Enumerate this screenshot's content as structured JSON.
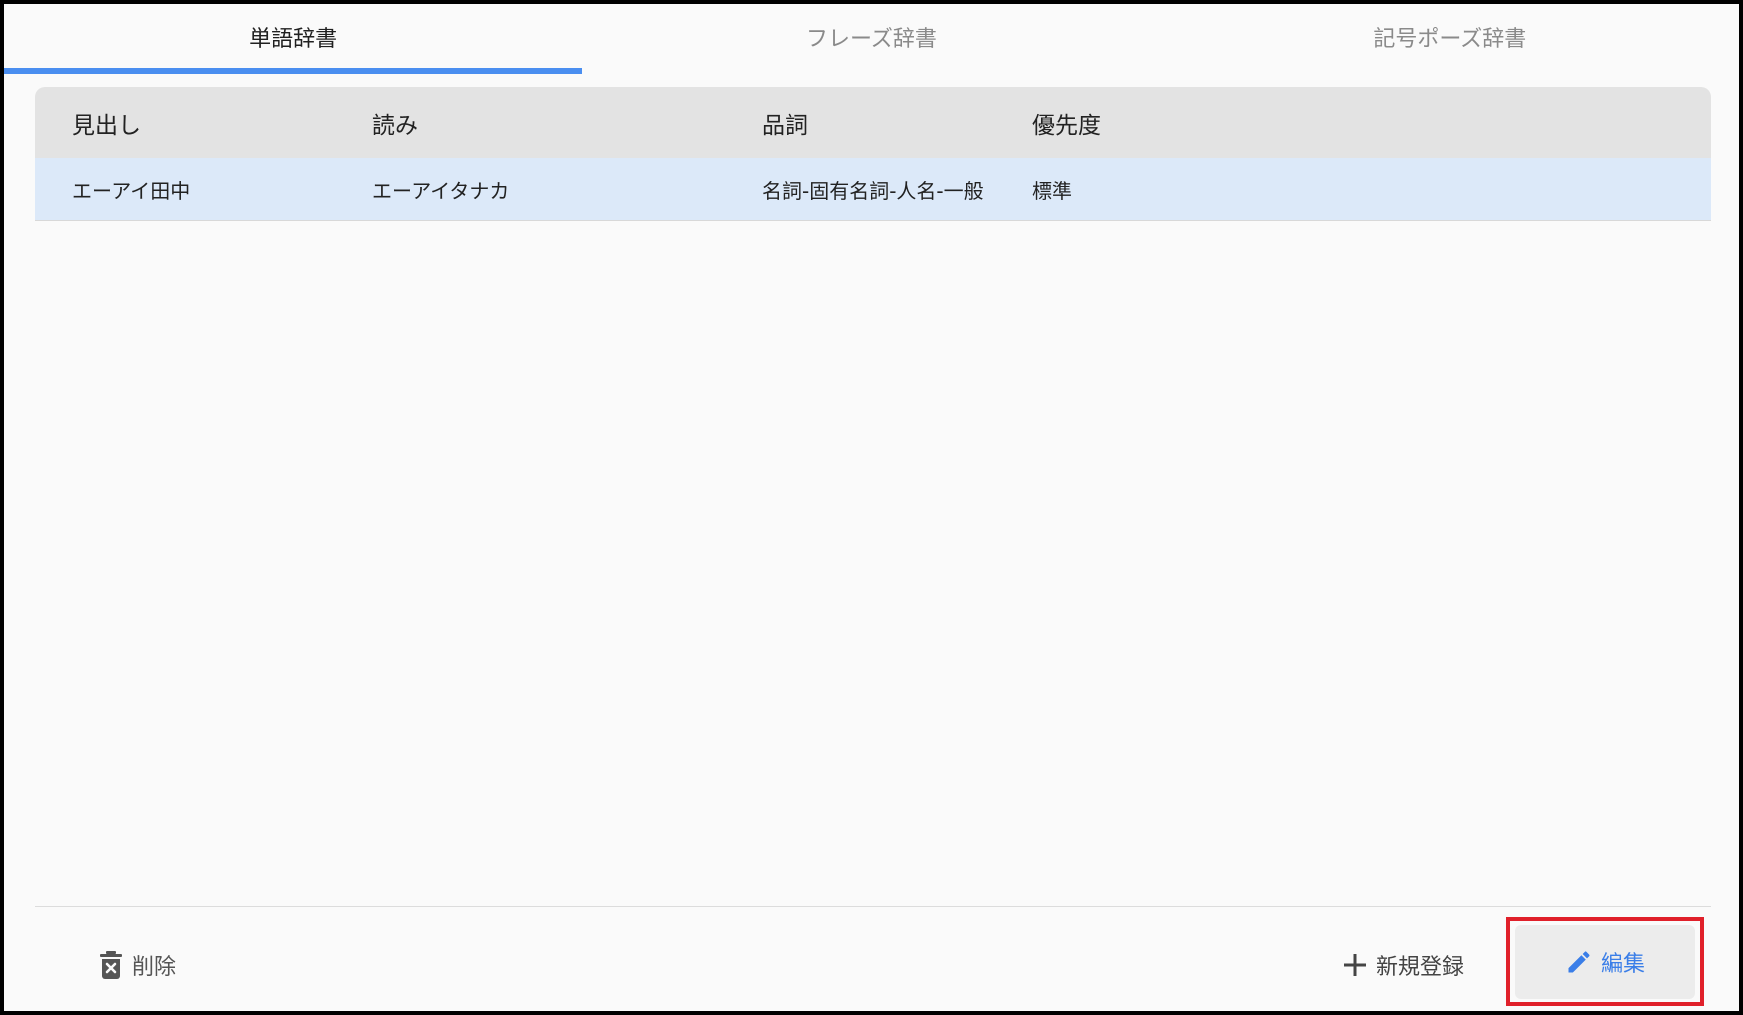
{
  "tabs": [
    {
      "label": "単語辞書",
      "active": true
    },
    {
      "label": "フレーズ辞書",
      "active": false
    },
    {
      "label": "記号ポーズ辞書",
      "active": false
    }
  ],
  "table": {
    "headers": [
      "見出し",
      "読み",
      "品詞",
      "優先度"
    ],
    "rows": [
      [
        "エーアイ田中",
        "エーアイタナカ",
        "名詞-固有名詞-人名-一般",
        "標準"
      ]
    ]
  },
  "footer": {
    "delete_label": "削除",
    "delete_icon": "trash-icon",
    "new_label": "新規登録",
    "new_icon": "plus-icon",
    "edit_label": "編集",
    "edit_icon": "pencil-icon"
  },
  "colors": {
    "accent": "#4a8ef0",
    "selected_row": "#dce9f9",
    "header_bg": "#e3e3e3",
    "highlight": "#e0202a"
  }
}
